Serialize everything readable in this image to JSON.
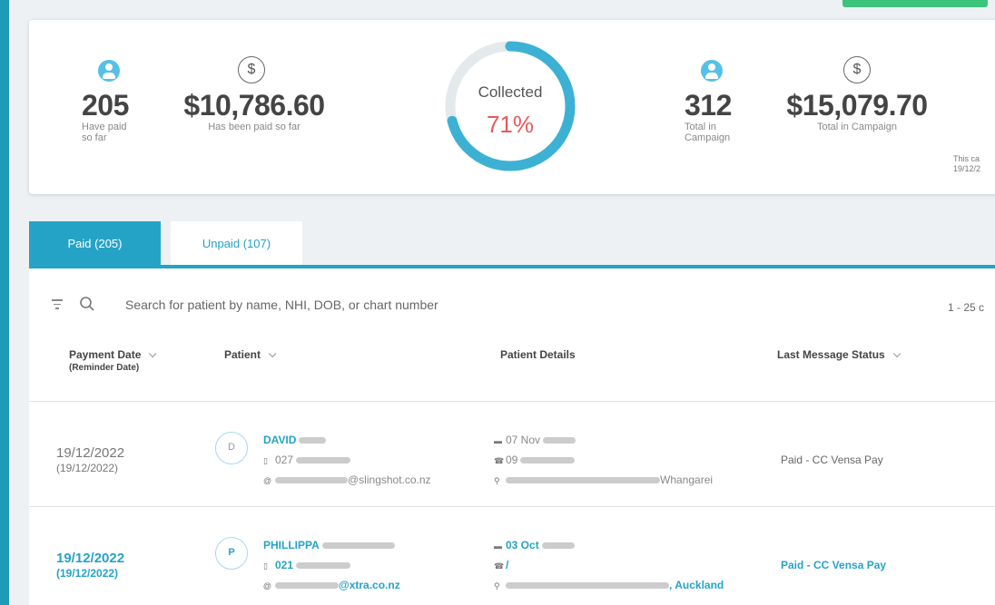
{
  "summary": {
    "paid_count": "205",
    "paid_count_label": "Have paid so far",
    "paid_amount": "$10,786.60",
    "paid_amount_label": "Has been paid so far",
    "gauge_label": "Collected",
    "gauge_value": "71%",
    "gauge_fraction": 0.71,
    "total_count": "312",
    "total_count_label": "Total in Campaign",
    "total_amount": "$15,079.70",
    "total_amount_label": "Total in Campaign",
    "campaign_note_line1": "This ca",
    "campaign_note_line2": "19/12/2"
  },
  "tabs": {
    "paid": "Paid (205)",
    "unpaid": "Unpaid (107)"
  },
  "search": {
    "placeholder": "Search for patient by name, NHI, DOB, or chart number",
    "pager": "1 - 25 c"
  },
  "columns": {
    "payment_date": "Payment Date",
    "payment_date_sub": "(Reminder Date)",
    "patient": "Patient",
    "patient_details": "Patient Details",
    "last_message_status": "Last Message Status"
  },
  "rows": [
    {
      "date": "19/12/2022",
      "reminder_date": "(19/12/2022)",
      "initial": "D",
      "name": "DAVID",
      "phone": "027",
      "email_suffix": "@slingshot.co.nz",
      "dob": "07 Nov",
      "alt_phone": "09",
      "city": "Whangarei",
      "status": "Paid - CC Vensa Pay"
    },
    {
      "date": "19/12/2022",
      "reminder_date": "(19/12/2022)",
      "initial": "P",
      "name": "PHILLIPPA",
      "phone": "021",
      "email_suffix": "@xtra.co.nz",
      "dob": "03 Oct",
      "alt_phone": "/",
      "city": ", Auckland",
      "status": "Paid - CC Vensa Pay"
    }
  ],
  "colors": {
    "accent": "#25a3c6",
    "gauge_track": "#e4e9ec",
    "collected": "#e85a5a"
  }
}
